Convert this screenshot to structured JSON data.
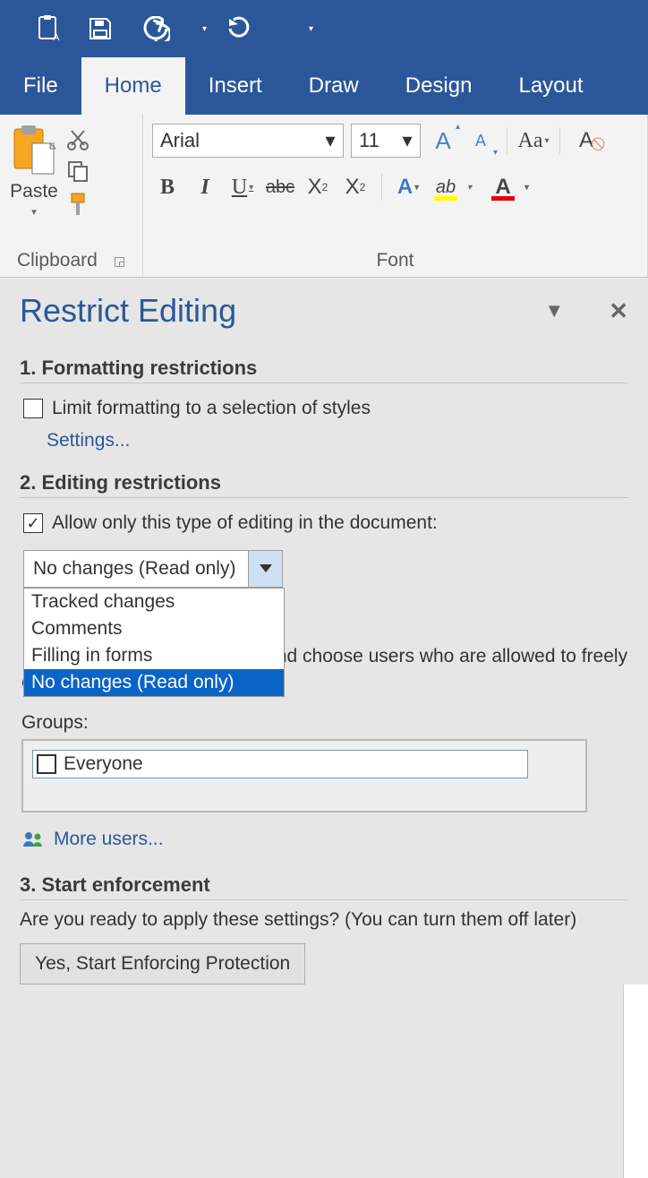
{
  "tabs": {
    "file": "File",
    "home": "Home",
    "insert": "Insert",
    "draw": "Draw",
    "design": "Design",
    "layout": "Layout"
  },
  "ribbon": {
    "paste": "Paste",
    "clipboard": "Clipboard",
    "font_group": "Font",
    "font_name": "Arial",
    "font_size": "11",
    "case": "Aa",
    "bold": "B",
    "italic": "I",
    "underline": "U",
    "strike": "abc",
    "sub_base": "X",
    "sub_suffix": "2",
    "sup_base": "X",
    "sup_suffix": "2",
    "texteffects": "A",
    "highlight_letters": "ab",
    "fontcolor_letter": "A"
  },
  "pane": {
    "title": "Restrict Editing",
    "sec1_title": "1. Formatting restrictions",
    "sec1_check": "Limit formatting to a selection of styles",
    "sec1_link": "Settings...",
    "sec2_title": "2. Editing restrictions",
    "sec2_check": "Allow only this type of editing in the document:",
    "sec2_select": "No changes (Read only)",
    "options": {
      "tracked": "Tracked changes",
      "comments": "Comments",
      "filling": "Filling in forms",
      "nochanges": "No changes (Read only)"
    },
    "exceptions_text_tail": "nd choose users who are allowed to freely edit them.",
    "groups_label": "Groups:",
    "group_everyone": "Everyone",
    "more_users": "More users...",
    "sec3_title": "3. Start enforcement",
    "sec3_text": "Are you ready to apply these settings? (You can turn them off later)",
    "sec3_button": "Yes, Start Enforcing Protection"
  }
}
